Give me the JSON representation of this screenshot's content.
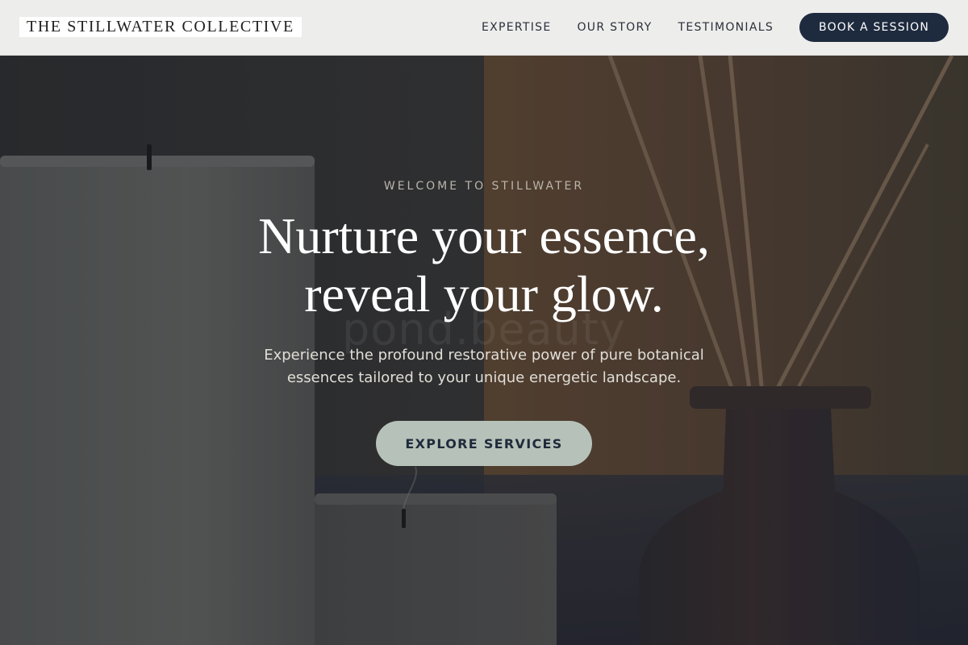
{
  "header": {
    "brand": "THE STILLWATER COLLECTIVE",
    "nav": {
      "expertise": "EXPERTISE",
      "our_story": "OUR STORY",
      "testimonials": "TESTIMONIALS"
    },
    "cta_label": "BOOK A SESSION"
  },
  "hero": {
    "eyebrow": "WELCOME TO STILLWATER",
    "headline_line1": "Nurture your essence,",
    "headline_line2": "reveal your glow.",
    "watermark": "pond.beauty",
    "subtext_line1": "Experience the profound restorative power of pure botanical",
    "subtext_line2": "essences tailored to your unique energetic landscape.",
    "button_label": "EXPLORE SERVICES",
    "background_image": "candles-and-reed-diffuser-photo"
  },
  "colors": {
    "header_bg": "#EDEDEC",
    "cta_bg": "#1E2A3E",
    "explore_bg": "#B6C2B9",
    "explore_text": "#1F2A3A",
    "headline_text": "#FFFFFF"
  }
}
